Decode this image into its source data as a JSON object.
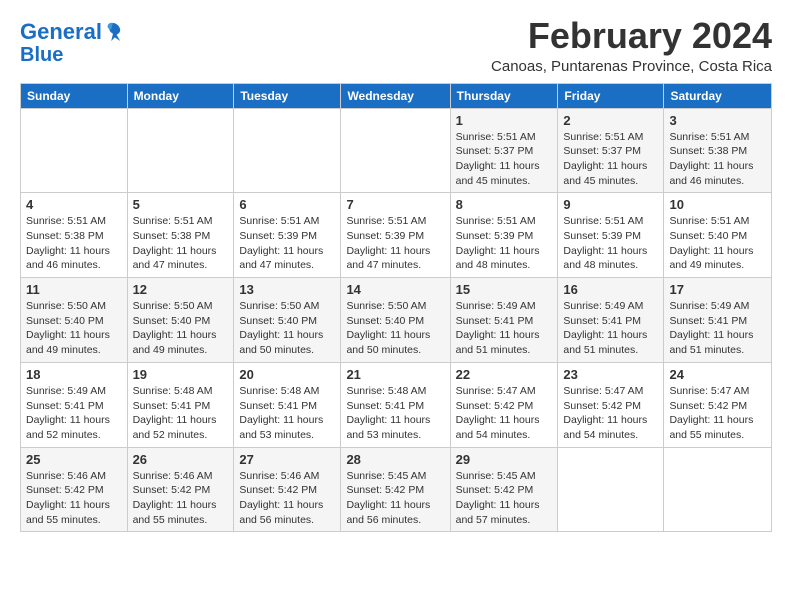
{
  "app": {
    "name": "GeneralBlue",
    "logo_line1": "General",
    "logo_line2": "Blue"
  },
  "header": {
    "month_year": "February 2024",
    "location": "Canoas, Puntarenas Province, Costa Rica"
  },
  "days_of_week": [
    "Sunday",
    "Monday",
    "Tuesday",
    "Wednesday",
    "Thursday",
    "Friday",
    "Saturday"
  ],
  "weeks": [
    [
      {
        "day": "",
        "info": ""
      },
      {
        "day": "",
        "info": ""
      },
      {
        "day": "",
        "info": ""
      },
      {
        "day": "",
        "info": ""
      },
      {
        "day": "1",
        "info": "Sunrise: 5:51 AM\nSunset: 5:37 PM\nDaylight: 11 hours and 45 minutes."
      },
      {
        "day": "2",
        "info": "Sunrise: 5:51 AM\nSunset: 5:37 PM\nDaylight: 11 hours and 45 minutes."
      },
      {
        "day": "3",
        "info": "Sunrise: 5:51 AM\nSunset: 5:38 PM\nDaylight: 11 hours and 46 minutes."
      }
    ],
    [
      {
        "day": "4",
        "info": "Sunrise: 5:51 AM\nSunset: 5:38 PM\nDaylight: 11 hours and 46 minutes."
      },
      {
        "day": "5",
        "info": "Sunrise: 5:51 AM\nSunset: 5:38 PM\nDaylight: 11 hours and 47 minutes."
      },
      {
        "day": "6",
        "info": "Sunrise: 5:51 AM\nSunset: 5:39 PM\nDaylight: 11 hours and 47 minutes."
      },
      {
        "day": "7",
        "info": "Sunrise: 5:51 AM\nSunset: 5:39 PM\nDaylight: 11 hours and 47 minutes."
      },
      {
        "day": "8",
        "info": "Sunrise: 5:51 AM\nSunset: 5:39 PM\nDaylight: 11 hours and 48 minutes."
      },
      {
        "day": "9",
        "info": "Sunrise: 5:51 AM\nSunset: 5:39 PM\nDaylight: 11 hours and 48 minutes."
      },
      {
        "day": "10",
        "info": "Sunrise: 5:51 AM\nSunset: 5:40 PM\nDaylight: 11 hours and 49 minutes."
      }
    ],
    [
      {
        "day": "11",
        "info": "Sunrise: 5:50 AM\nSunset: 5:40 PM\nDaylight: 11 hours and 49 minutes."
      },
      {
        "day": "12",
        "info": "Sunrise: 5:50 AM\nSunset: 5:40 PM\nDaylight: 11 hours and 49 minutes."
      },
      {
        "day": "13",
        "info": "Sunrise: 5:50 AM\nSunset: 5:40 PM\nDaylight: 11 hours and 50 minutes."
      },
      {
        "day": "14",
        "info": "Sunrise: 5:50 AM\nSunset: 5:40 PM\nDaylight: 11 hours and 50 minutes."
      },
      {
        "day": "15",
        "info": "Sunrise: 5:49 AM\nSunset: 5:41 PM\nDaylight: 11 hours and 51 minutes."
      },
      {
        "day": "16",
        "info": "Sunrise: 5:49 AM\nSunset: 5:41 PM\nDaylight: 11 hours and 51 minutes."
      },
      {
        "day": "17",
        "info": "Sunrise: 5:49 AM\nSunset: 5:41 PM\nDaylight: 11 hours and 51 minutes."
      }
    ],
    [
      {
        "day": "18",
        "info": "Sunrise: 5:49 AM\nSunset: 5:41 PM\nDaylight: 11 hours and 52 minutes."
      },
      {
        "day": "19",
        "info": "Sunrise: 5:48 AM\nSunset: 5:41 PM\nDaylight: 11 hours and 52 minutes."
      },
      {
        "day": "20",
        "info": "Sunrise: 5:48 AM\nSunset: 5:41 PM\nDaylight: 11 hours and 53 minutes."
      },
      {
        "day": "21",
        "info": "Sunrise: 5:48 AM\nSunset: 5:41 PM\nDaylight: 11 hours and 53 minutes."
      },
      {
        "day": "22",
        "info": "Sunrise: 5:47 AM\nSunset: 5:42 PM\nDaylight: 11 hours and 54 minutes."
      },
      {
        "day": "23",
        "info": "Sunrise: 5:47 AM\nSunset: 5:42 PM\nDaylight: 11 hours and 54 minutes."
      },
      {
        "day": "24",
        "info": "Sunrise: 5:47 AM\nSunset: 5:42 PM\nDaylight: 11 hours and 55 minutes."
      }
    ],
    [
      {
        "day": "25",
        "info": "Sunrise: 5:46 AM\nSunset: 5:42 PM\nDaylight: 11 hours and 55 minutes."
      },
      {
        "day": "26",
        "info": "Sunrise: 5:46 AM\nSunset: 5:42 PM\nDaylight: 11 hours and 55 minutes."
      },
      {
        "day": "27",
        "info": "Sunrise: 5:46 AM\nSunset: 5:42 PM\nDaylight: 11 hours and 56 minutes."
      },
      {
        "day": "28",
        "info": "Sunrise: 5:45 AM\nSunset: 5:42 PM\nDaylight: 11 hours and 56 minutes."
      },
      {
        "day": "29",
        "info": "Sunrise: 5:45 AM\nSunset: 5:42 PM\nDaylight: 11 hours and 57 minutes."
      },
      {
        "day": "",
        "info": ""
      },
      {
        "day": "",
        "info": ""
      }
    ]
  ]
}
